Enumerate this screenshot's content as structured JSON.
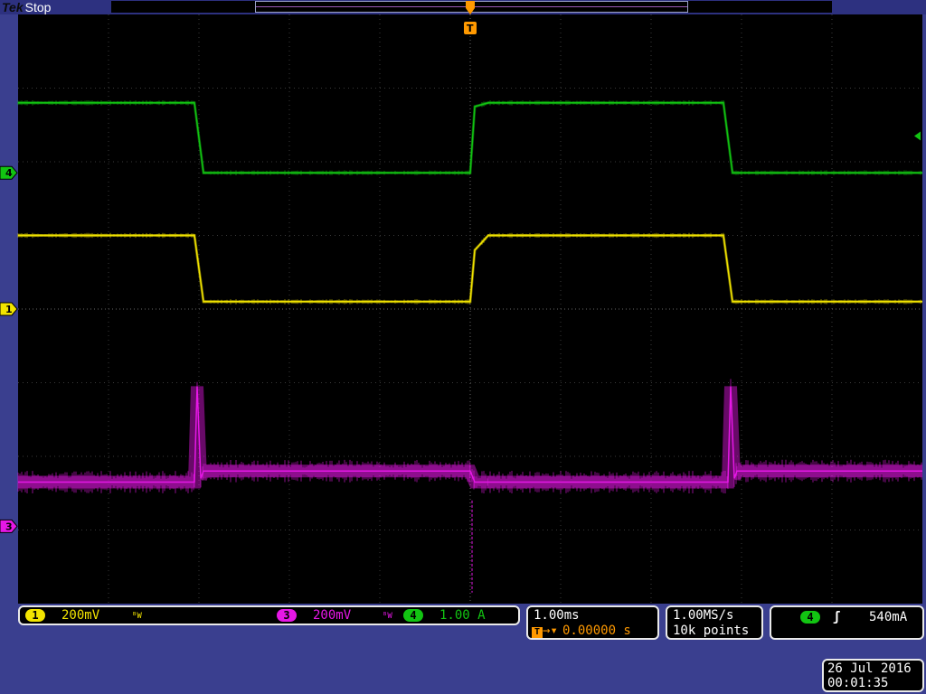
{
  "header": {
    "brand": "Tek",
    "run_state": "Stop",
    "trigger_marker": "T"
  },
  "channels": [
    {
      "id": "1",
      "scale": "200mV",
      "bandwidth_icon": "bandwidth-limit-icon",
      "color": "#f2e400"
    },
    {
      "id": "3",
      "scale": "200mV",
      "bandwidth_icon": "bandwidth-limit-icon",
      "color": "#e617e6"
    },
    {
      "id": "4",
      "scale": "1.00 A",
      "color": "#12c412"
    }
  ],
  "timebase": {
    "scale": "1.00ms",
    "trigger_delay": "0.00000 s",
    "trigger_icon": "trigger-delay-icon"
  },
  "acquisition": {
    "sample_rate": "1.00MS/s",
    "record_length": "10k points"
  },
  "trigger": {
    "source": "4",
    "slope_icon": "rising-edge-icon",
    "level": "540mA"
  },
  "datetime": {
    "date": "26 Jul  2016",
    "time": "00:01:35"
  },
  "chart_data": {
    "type": "line",
    "title": "",
    "xlabel": "",
    "ylabel": "",
    "grid": true,
    "xlim": [
      -5,
      5
    ],
    "x_units": "ms",
    "ylim": [
      -4,
      4
    ],
    "y_units": "divisions",
    "trigger_position": 0,
    "series": [
      {
        "name": "4",
        "color": "#12c412",
        "x": [
          -5,
          -3.05,
          -2.95,
          0,
          0.05,
          0.2,
          2.8,
          2.9,
          5
        ],
        "y": [
          2.8,
          2.8,
          1.85,
          1.85,
          2.75,
          2.8,
          2.8,
          1.85,
          1.85
        ]
      },
      {
        "name": "1",
        "color": "#f2e400",
        "x": [
          -5,
          -3.05,
          -2.95,
          0,
          0.05,
          0.2,
          2.8,
          2.9,
          5
        ],
        "y": [
          1.0,
          1.0,
          0.1,
          0.1,
          0.8,
          1.0,
          1.0,
          0.1,
          0.1
        ]
      },
      {
        "name": "3",
        "color": "#e617e6",
        "x": [
          -5,
          -3.05,
          -3.02,
          -2.98,
          -2.95,
          0,
          0.05,
          0.2,
          2.85,
          2.88,
          2.92,
          2.95,
          5
        ],
        "y": [
          -2.35,
          -2.35,
          -1.05,
          -2.3,
          -2.2,
          -2.2,
          -2.35,
          -2.35,
          -2.35,
          -1.05,
          -2.3,
          -2.2,
          -2.2
        ]
      }
    ]
  }
}
